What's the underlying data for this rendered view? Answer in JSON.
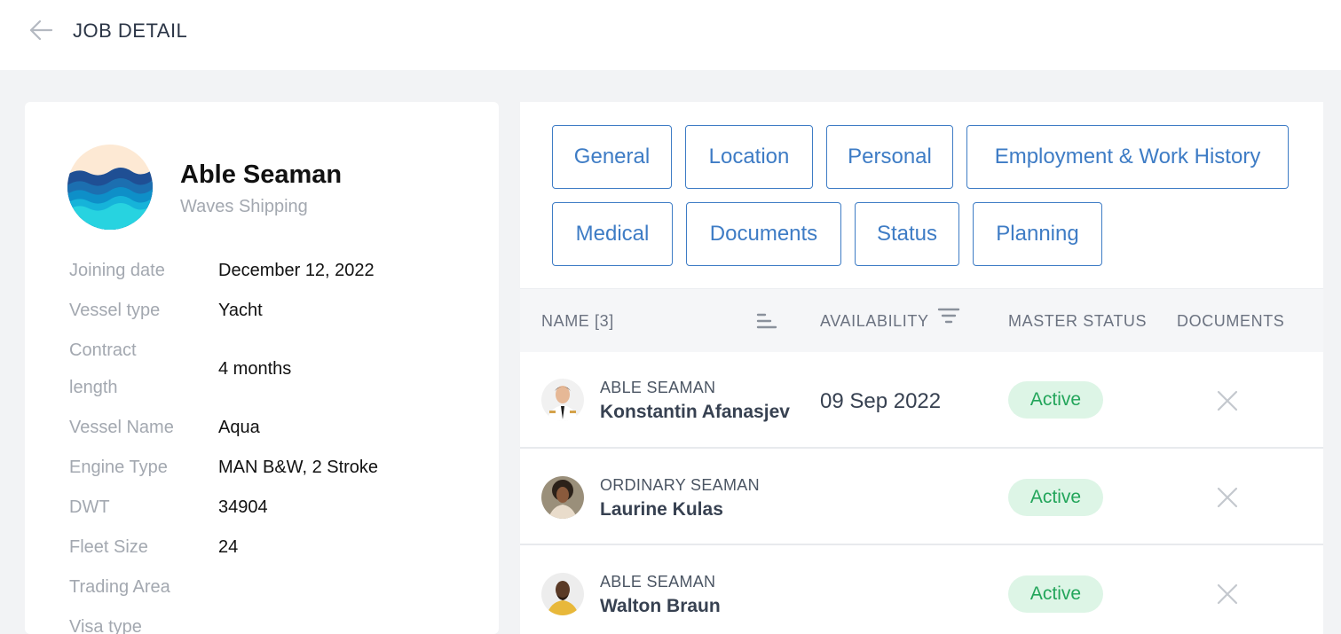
{
  "header": {
    "title": "JOB DETAIL",
    "back_icon": "arrow-left-icon"
  },
  "job": {
    "title": "Able Seaman",
    "company": "Waves Shipping",
    "logo_icon": "waves-logo-icon",
    "details": [
      {
        "label": "Joining date",
        "value": "December 12, 2022"
      },
      {
        "label": "Vessel type",
        "value": "Yacht"
      },
      {
        "label": "Contract length",
        "value": "4 months"
      },
      {
        "label": "Vessel Name",
        "value": "Aqua"
      },
      {
        "label": "Engine Type",
        "value": "MAN B&W, 2 Stroke"
      },
      {
        "label": "DWT",
        "value": "34904"
      },
      {
        "label": "Fleet Size",
        "value": "24"
      },
      {
        "label": "Trading Area",
        "value": ""
      },
      {
        "label": "Visa type",
        "value": ""
      }
    ]
  },
  "tabs": [
    {
      "label": "General"
    },
    {
      "label": "Location"
    },
    {
      "label": "Personal"
    },
    {
      "label": "Employment & Work History"
    },
    {
      "label": "Medical"
    },
    {
      "label": "Documents"
    },
    {
      "label": "Status"
    },
    {
      "label": "Planning"
    }
  ],
  "table": {
    "columns": {
      "name": "NAME [3]",
      "availability": "AVAILABILITY",
      "master_status": "MASTER STATUS",
      "documents": "DOCUMENTS"
    },
    "rows": [
      {
        "role": "ABLE SEAMAN",
        "name": "Konstantin Afanasjev",
        "availability": "09 Sep 2022",
        "status": "Active",
        "documents_icon": "close-icon"
      },
      {
        "role": "ORDINARY SEAMAN",
        "name": "Laurine Kulas",
        "availability": "",
        "status": "Active",
        "documents_icon": "close-icon"
      },
      {
        "role": "ABLE SEAMAN",
        "name": "Walton Braun",
        "availability": "",
        "status": "Active",
        "documents_icon": "close-icon"
      }
    ]
  },
  "colors": {
    "accent": "#3e7cc5",
    "status_bg": "#ddf5e6",
    "status_text": "#22a55a"
  }
}
